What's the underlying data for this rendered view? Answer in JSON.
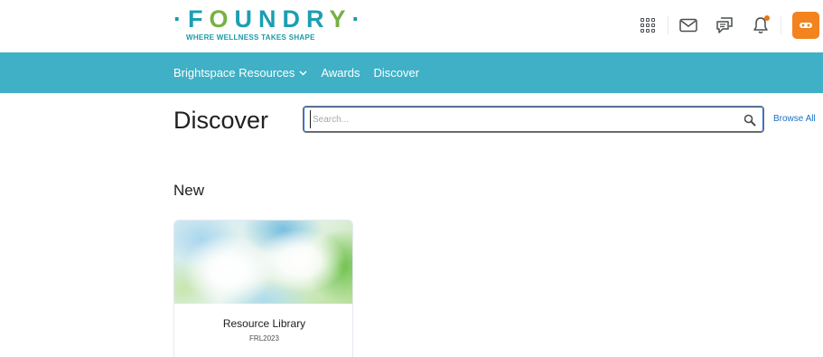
{
  "brand": {
    "logo_letters": [
      "F",
      "O",
      "U",
      "N",
      "D",
      "R",
      "Y"
    ],
    "tagline": "WHERE WELLNESS TAKES SHAPE",
    "colors": {
      "teal": "#1a9fb3",
      "green": "#78b043"
    }
  },
  "header": {
    "icons": [
      {
        "name": "waffle-icon"
      },
      {
        "name": "mail-icon"
      },
      {
        "name": "chat-icon"
      },
      {
        "name": "bell-icon",
        "has_notification": true
      }
    ],
    "avatar_color": "#f2831f"
  },
  "nav": {
    "bg_color": "#3fb0c6",
    "items": [
      {
        "label": "Brightspace Resources",
        "has_dropdown": true
      },
      {
        "label": "Awards"
      },
      {
        "label": "Discover"
      }
    ]
  },
  "discover": {
    "title": "Discover",
    "search": {
      "placeholder": "Search...",
      "value": ""
    },
    "browse_all": "Browse All"
  },
  "sections": {
    "new": {
      "title": "New",
      "cards": [
        {
          "title": "Resource Library",
          "code": "FRL2023"
        }
      ]
    }
  }
}
